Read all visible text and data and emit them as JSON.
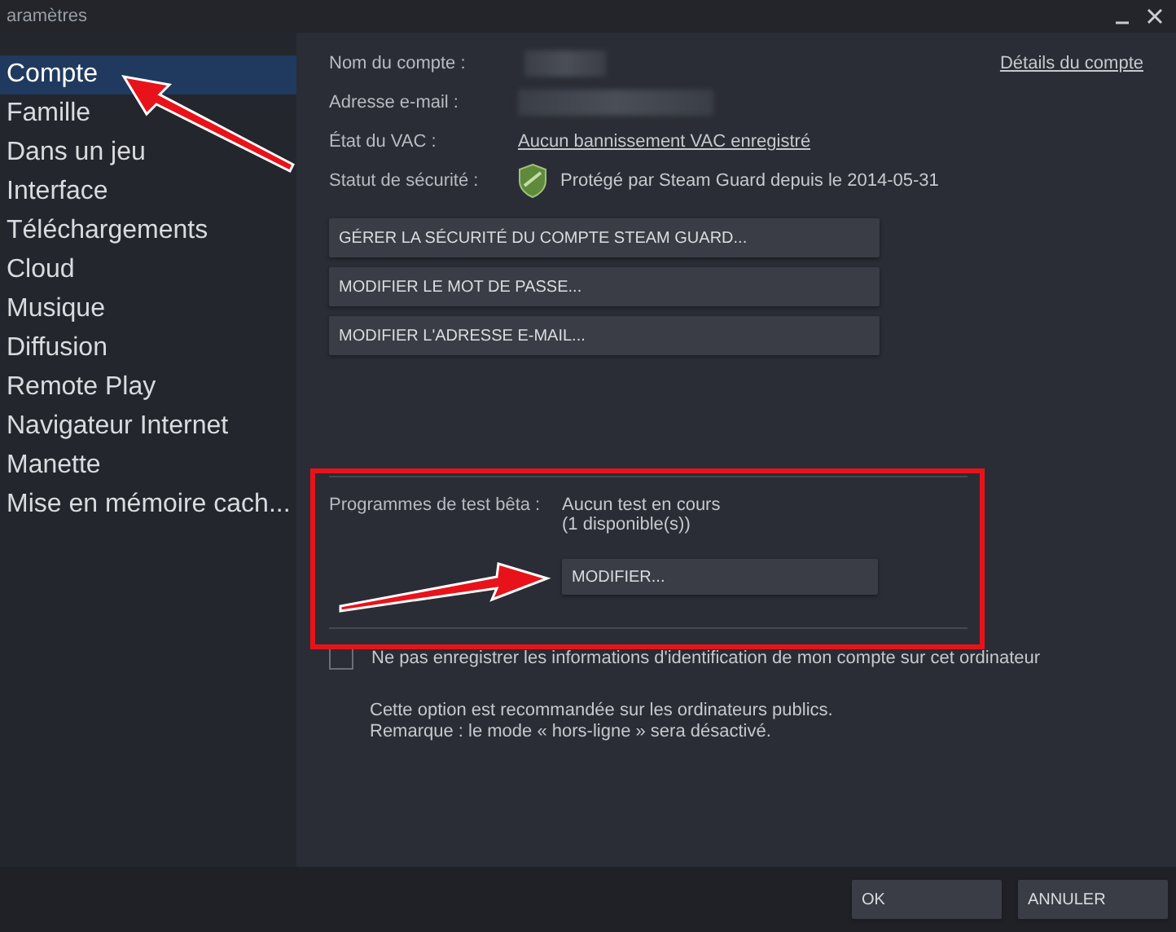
{
  "window": {
    "title": "aramètres"
  },
  "sidebar": {
    "items": [
      {
        "label": "Compte",
        "selected": true
      },
      {
        "label": "Famille",
        "selected": false
      },
      {
        "label": "Dans un jeu",
        "selected": false
      },
      {
        "label": "Interface",
        "selected": false
      },
      {
        "label": "Téléchargements",
        "selected": false
      },
      {
        "label": "Cloud",
        "selected": false
      },
      {
        "label": "Musique",
        "selected": false
      },
      {
        "label": "Diffusion",
        "selected": false
      },
      {
        "label": "Remote Play",
        "selected": false
      },
      {
        "label": "Navigateur Internet",
        "selected": false
      },
      {
        "label": "Manette",
        "selected": false
      },
      {
        "label": "Mise en mémoire cach...",
        "selected": false
      }
    ]
  },
  "account": {
    "details_link": "Détails du compte",
    "fields": [
      {
        "label": "Nom du compte :",
        "kind": "blurred"
      },
      {
        "label": "Adresse e-mail :",
        "kind": "blurred"
      },
      {
        "label": "État du VAC :",
        "kind": "link",
        "value": "Aucun bannissement VAC enregistré"
      },
      {
        "label": "Statut de sécurité :",
        "kind": "shield",
        "value": "Protégé par Steam Guard depuis le 2014-05-31"
      }
    ],
    "buttons": [
      "GÉRER LA SÉCURITÉ DU COMPTE STEAM GUARD...",
      "MODIFIER LE MOT DE PASSE...",
      "MODIFIER L'ADRESSE E-MAIL..."
    ]
  },
  "beta": {
    "label": "Programmes de test bêta :",
    "status": [
      "Aucun test en cours",
      "(1 disponible(s))"
    ],
    "button": "MODIFIER..."
  },
  "remember": {
    "label": "Ne pas enregistrer les informations d'identification de mon compte sur cet ordinateur",
    "checked": false,
    "note": [
      "Cette option est recommandée sur les ordinateurs publics.",
      "Remarque : le mode « hors-ligne » sera désactivé."
    ]
  },
  "footer": {
    "buttons": [
      "OK",
      "ANNULER"
    ]
  }
}
